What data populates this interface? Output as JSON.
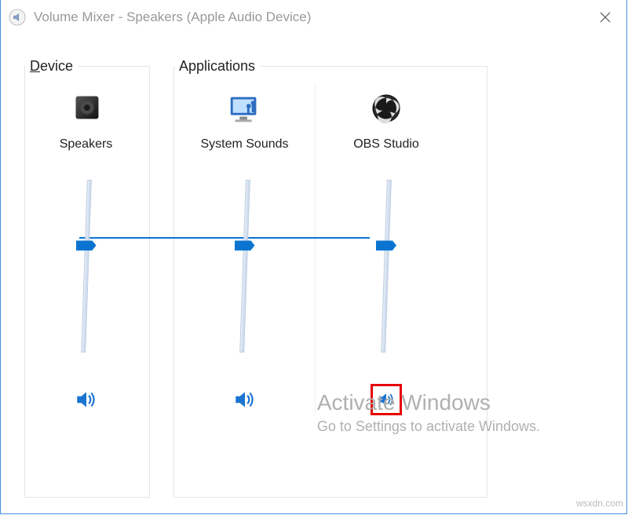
{
  "window": {
    "title": "Volume Mixer - Speakers (Apple Audio Device)"
  },
  "sections": {
    "device_label": "Device",
    "applications_label": "Applications"
  },
  "device": {
    "label": "Speakers",
    "volume": 62,
    "muted": false
  },
  "applications": [
    {
      "label": "System Sounds",
      "volume": 62,
      "muted": false,
      "icon": "monitor-sound"
    },
    {
      "label": "OBS Studio",
      "volume": 62,
      "muted": false,
      "icon": "obs",
      "highlighted": true
    }
  ],
  "watermark": {
    "line1": "Activate Windows",
    "line2": "Go to Settings to activate Windows."
  },
  "corner": "wsxdn.com"
}
